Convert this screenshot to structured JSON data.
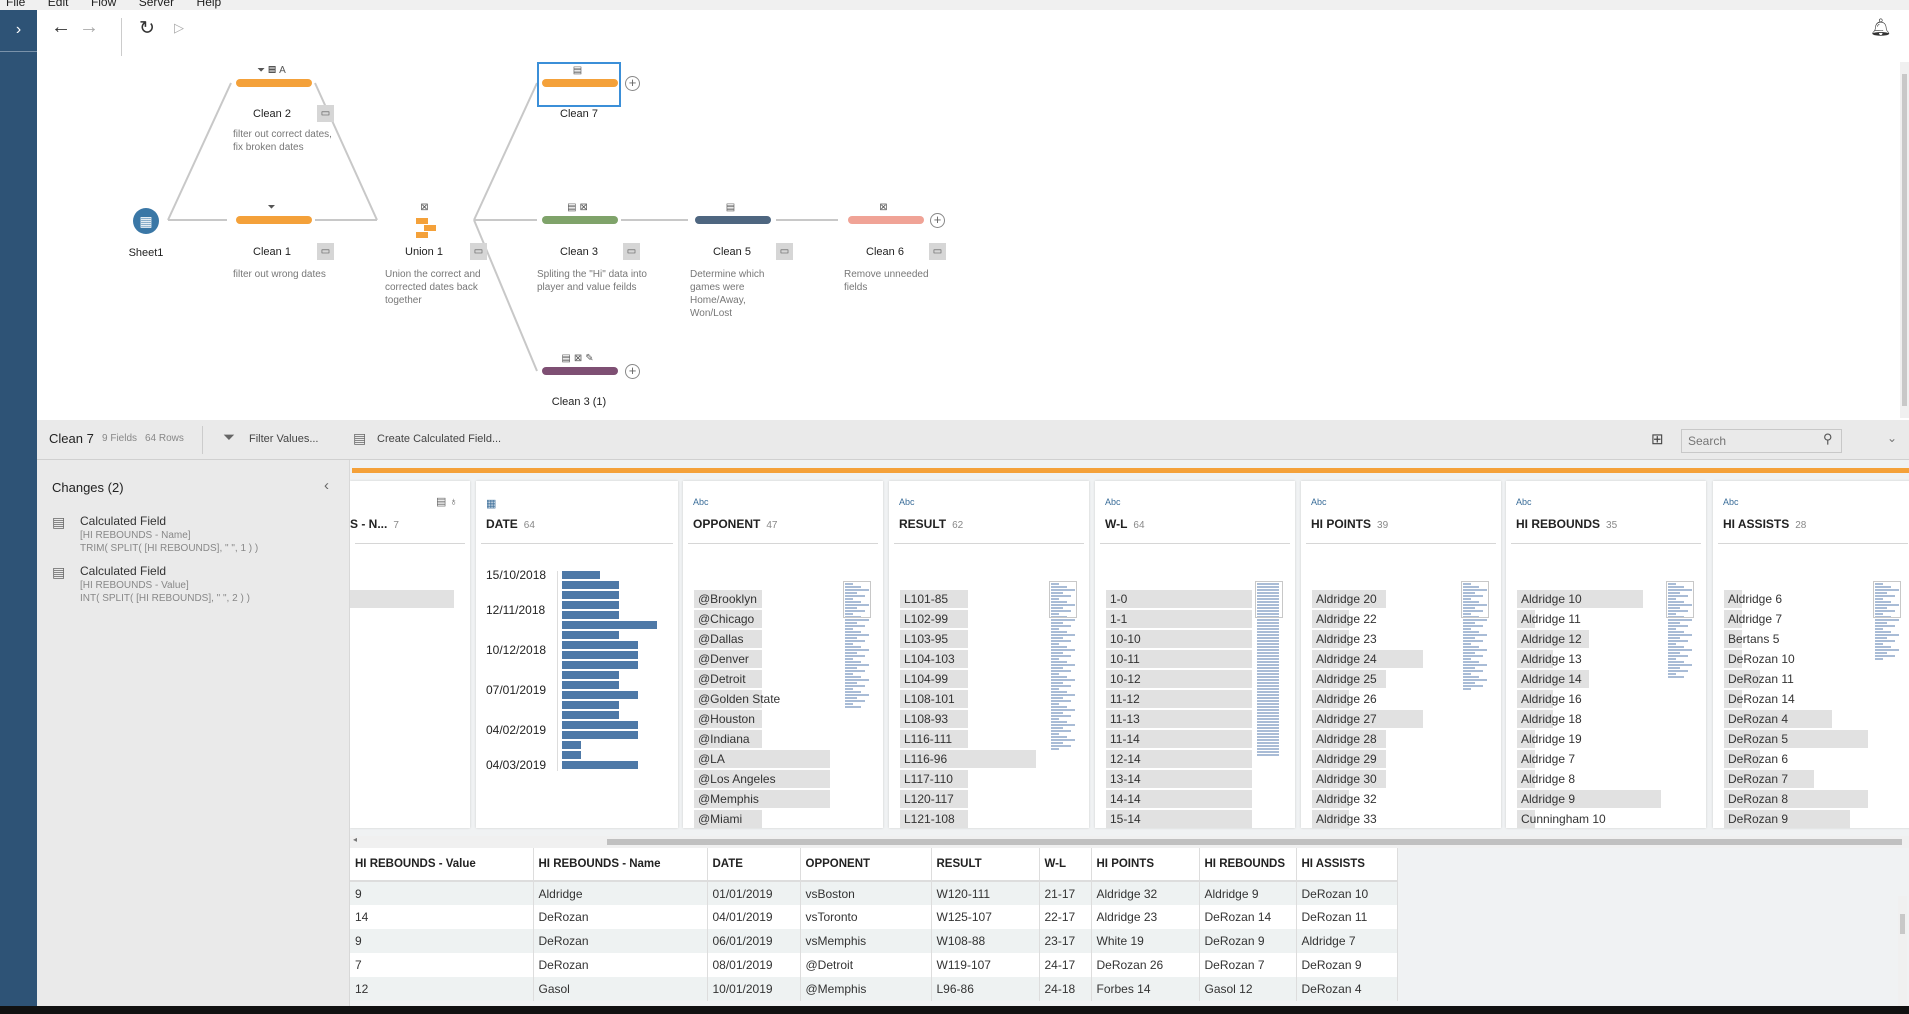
{
  "menu": [
    "File",
    "Edit",
    "Flow",
    "Server",
    "Help"
  ],
  "flow": {
    "nodes": {
      "sheet1": {
        "label": "Sheet1"
      },
      "clean2": {
        "label": "Clean 2",
        "desc": "filter out correct dates, fix broken dates",
        "color": "#f4a13a"
      },
      "clean1": {
        "label": "Clean 1",
        "desc": "filter out wrong dates",
        "color": "#f4a13a"
      },
      "union1": {
        "label": "Union 1",
        "desc": "Union the correct and corrected dates back together"
      },
      "clean7": {
        "label": "Clean 7",
        "color": "#f4a13a"
      },
      "clean3": {
        "label": "Clean 3",
        "desc": "Spliting the \"Hi\" data into player and value feilds",
        "color": "#7fa36a"
      },
      "clean5": {
        "label": "Clean 5",
        "desc": "Determine which games were Home/Away, Won/Lost",
        "color": "#4e6680"
      },
      "clean6": {
        "label": "Clean 6",
        "desc": "Remove unneeded fields",
        "color": "#f0a396"
      },
      "clean31": {
        "label": "Clean 3 (1)",
        "color": "#7e4f73"
      }
    }
  },
  "toolbar": {
    "step": "Clean 7",
    "fields": "9 Fields",
    "rows": "64 Rows",
    "filter": "Filter Values...",
    "calc": "Create Calculated Field...",
    "search_placeholder": "Search"
  },
  "changes": {
    "title": "Changes (2)",
    "items": [
      {
        "type": "Calculated Field",
        "field": "[HI REBOUNDS - Name]",
        "formula": "TRIM( SPLIT( [HI REBOUNDS], \" \", 1 ) )"
      },
      {
        "type": "Calculated Field",
        "field": "[HI REBOUNDS - Value]",
        "formula": "INT( SPLIT( [HI REBOUNDS], \" \", 2 ) )"
      }
    ]
  },
  "profile": {
    "partial": {
      "name": "S - N...",
      "count": "7"
    },
    "date": {
      "type": "calendar",
      "name": "DATE",
      "count": "64",
      "ticks": [
        "15/10/2018",
        "12/11/2018",
        "10/12/2018",
        "07/01/2019",
        "04/02/2019",
        "04/03/2019"
      ],
      "bins": [
        2,
        3,
        3,
        3,
        3,
        5,
        3,
        4,
        4,
        4,
        3,
        3,
        4,
        3,
        3,
        4,
        4,
        1,
        1,
        4
      ]
    },
    "cards": [
      {
        "type": "Abc",
        "name": "OPPONENT",
        "count": "47",
        "items": [
          [
            "@Brooklyn",
            1
          ],
          [
            "@Chicago",
            1
          ],
          [
            "@Dallas",
            1
          ],
          [
            "@Denver",
            1
          ],
          [
            "@Detroit",
            1
          ],
          [
            "@Golden State",
            1
          ],
          [
            "@Houston",
            1
          ],
          [
            "@Indiana",
            1
          ],
          [
            "@LA",
            2
          ],
          [
            "@Los Angeles",
            2
          ],
          [
            "@Memphis",
            2
          ],
          [
            "@Miami",
            1
          ]
        ],
        "max": 2
      },
      {
        "type": "Abc",
        "name": "RESULT",
        "count": "62",
        "items": [
          [
            "L101-85",
            1
          ],
          [
            "L102-99",
            1
          ],
          [
            "L103-95",
            1
          ],
          [
            "L104-103",
            1
          ],
          [
            "L104-99",
            1
          ],
          [
            "L108-101",
            1
          ],
          [
            "L108-93",
            1
          ],
          [
            "L116-111",
            1
          ],
          [
            "L116-96",
            2
          ],
          [
            "L117-110",
            1
          ],
          [
            "L120-117",
            1
          ],
          [
            "L121-108",
            1
          ]
        ],
        "max": 2
      },
      {
        "type": "Abc",
        "name": "W-L",
        "count": "64",
        "items": [
          [
            "1-0",
            1
          ],
          [
            "1-1",
            1
          ],
          [
            "10-10",
            1
          ],
          [
            "10-11",
            1
          ],
          [
            "10-12",
            1
          ],
          [
            "11-12",
            1
          ],
          [
            "11-13",
            1
          ],
          [
            "11-14",
            1
          ],
          [
            "12-14",
            1
          ],
          [
            "13-14",
            1
          ],
          [
            "14-14",
            1
          ],
          [
            "15-14",
            1
          ]
        ],
        "max": 1
      },
      {
        "type": "Abc",
        "name": "HI POINTS",
        "count": "39",
        "items": [
          [
            "Aldridge 20",
            2
          ],
          [
            "Aldridge 22",
            1
          ],
          [
            "Aldridge 23",
            1
          ],
          [
            "Aldridge 24",
            3
          ],
          [
            "Aldridge 25",
            2
          ],
          [
            "Aldridge 26",
            1
          ],
          [
            "Aldridge 27",
            3
          ],
          [
            "Aldridge 28",
            2
          ],
          [
            "Aldridge 29",
            2
          ],
          [
            "Aldridge 30",
            2
          ],
          [
            "Aldridge 32",
            1
          ],
          [
            "Aldridge 33",
            1
          ]
        ],
        "max": 4
      },
      {
        "type": "Abc",
        "name": "HI REBOUNDS",
        "count": "35",
        "items": [
          [
            "Aldridge 10",
            7
          ],
          [
            "Aldridge 11",
            1
          ],
          [
            "Aldridge 12",
            4
          ],
          [
            "Aldridge 13",
            2
          ],
          [
            "Aldridge 14",
            4
          ],
          [
            "Aldridge 16",
            2
          ],
          [
            "Aldridge 18",
            2
          ],
          [
            "Aldridge 19",
            1
          ],
          [
            "Aldridge 7",
            1
          ],
          [
            "Aldridge 8",
            1
          ],
          [
            "Aldridge 9",
            8
          ],
          [
            "Cunningham 10",
            1
          ]
        ],
        "max": 16
      },
      {
        "type": "Abc",
        "name": "HI ASSISTS",
        "count": "28",
        "items": [
          [
            "Aldridge 6",
            1
          ],
          [
            "Aldridge 7",
            1
          ],
          [
            "Bertans 5",
            1
          ],
          [
            "DeRozan 10",
            1
          ],
          [
            "DeRozan 11",
            2
          ],
          [
            "DeRozan 14",
            1
          ],
          [
            "DeRozan 4",
            6
          ],
          [
            "DeRozan 5",
            8
          ],
          [
            "DeRozan 6",
            2
          ],
          [
            "DeRozan 7",
            5
          ],
          [
            "DeRozan 8",
            8
          ],
          [
            "DeRozan 9",
            7
          ]
        ],
        "max": 9
      }
    ]
  },
  "grid": {
    "columns": [
      "HI REBOUNDS - Value",
      "HI REBOUNDS - Name",
      "DATE",
      "OPPONENT",
      "RESULT",
      "W-L",
      "HI POINTS",
      "HI REBOUNDS",
      "HI ASSISTS"
    ],
    "rows": [
      [
        "9",
        "Aldridge",
        "01/01/2019",
        "vsBoston",
        "W120-111",
        "21-17",
        "Aldridge 32",
        "Aldridge 9",
        "DeRozan 10"
      ],
      [
        "14",
        "DeRozan",
        "04/01/2019",
        "vsToronto",
        "W125-107",
        "22-17",
        "Aldridge 23",
        "DeRozan 14",
        "DeRozan 11"
      ],
      [
        "9",
        "DeRozan",
        "06/01/2019",
        "vsMemphis",
        "W108-88",
        "23-17",
        "White 19",
        "DeRozan 9",
        "Aldridge 7"
      ],
      [
        "7",
        "DeRozan",
        "08/01/2019",
        "@Detroit",
        "W119-107",
        "24-17",
        "DeRozan 26",
        "DeRozan 7",
        "DeRozan 9"
      ],
      [
        "12",
        "Gasol",
        "10/01/2019",
        "@Memphis",
        "L96-86",
        "24-18",
        "Forbes 14",
        "Gasol 12",
        "DeRozan 4"
      ]
    ]
  }
}
